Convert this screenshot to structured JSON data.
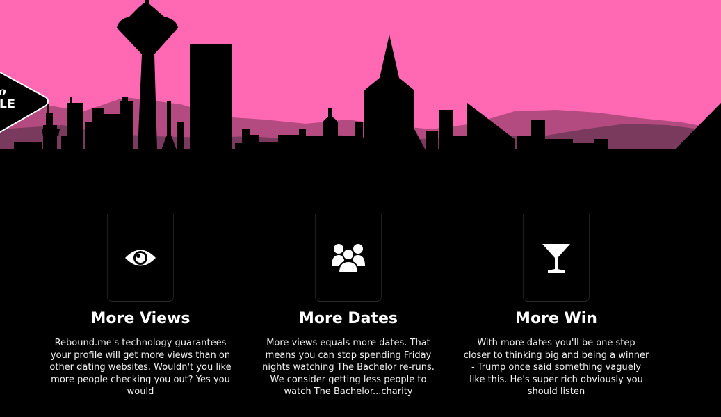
{
  "hero": {
    "badge_top": "o",
    "badge_bottom": "LE",
    "sky_color": "#ff69b4",
    "mountain_color": "#8a3f66"
  },
  "features": [
    {
      "icon": "eye-icon",
      "title": "More Views",
      "description": "Rebound.me's technology guarantees your profile will get more views than on other dating websites. Wouldn't you like more people checking you out? Yes you would"
    },
    {
      "icon": "users-icon",
      "title": "More Dates",
      "description": "More views equals more dates. That means you can stop spending Friday nights watching The Bachelor re-runs. We consider getting less people to watch The Bachelor...charity"
    },
    {
      "icon": "cocktail-glass-icon",
      "title": "More Win",
      "description": "With more dates you'll be one step closer to thinking big and being a winner - Trump once said something vaguely like this. He's super rich obviously you should listen"
    }
  ]
}
